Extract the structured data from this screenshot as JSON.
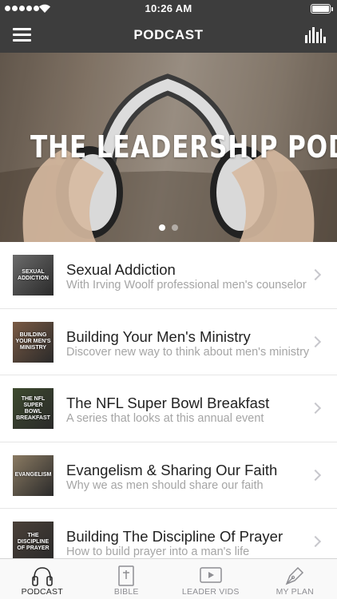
{
  "status_bar": {
    "time": "10:26 AM"
  },
  "nav": {
    "title": "PODCAST"
  },
  "hero": {
    "title": "THE LEADERSHIP PODCAST",
    "page_count": 2,
    "active_page": 1
  },
  "episodes": [
    {
      "title": "Sexual Addiction",
      "subtitle": "With Irving Woolf professional men's counselor",
      "thumb_text": "Sexual Addiction",
      "thumb_color": "#6b6b6b"
    },
    {
      "title": "Building Your Men's Ministry",
      "subtitle": "Discover new way to think about men's ministry",
      "thumb_text": "Building Your Men's Ministry",
      "thumb_color": "#7a5a44"
    },
    {
      "title": "The NFL Super Bowl Breakfast",
      "subtitle": "A series that looks at this annual event",
      "thumb_text": "The NFL Super Bowl Breakfast",
      "thumb_color": "#3d4a2e"
    },
    {
      "title": "Evangelism & Sharing Our Faith",
      "subtitle": "Why we as men should share our faith",
      "thumb_text": "Evangelism",
      "thumb_color": "#8a7a62"
    },
    {
      "title": "Building The Discipline Of Prayer",
      "subtitle": "How to build prayer into a man's life",
      "thumb_text": "The Discipline of Prayer",
      "thumb_color": "#4a4038"
    }
  ],
  "tabs": [
    {
      "label": "PODCAST",
      "icon": "headphones-icon",
      "active": true
    },
    {
      "label": "BIBLE",
      "icon": "bible-icon",
      "active": false
    },
    {
      "label": "LEADER VIDS",
      "icon": "video-play-icon",
      "active": false
    },
    {
      "label": "MY PLAN",
      "icon": "pen-nib-icon",
      "active": false
    }
  ],
  "colors": {
    "bar_background": "#3d3d3d",
    "accent": "#ffffff",
    "chevron": "#c7c7cc"
  }
}
